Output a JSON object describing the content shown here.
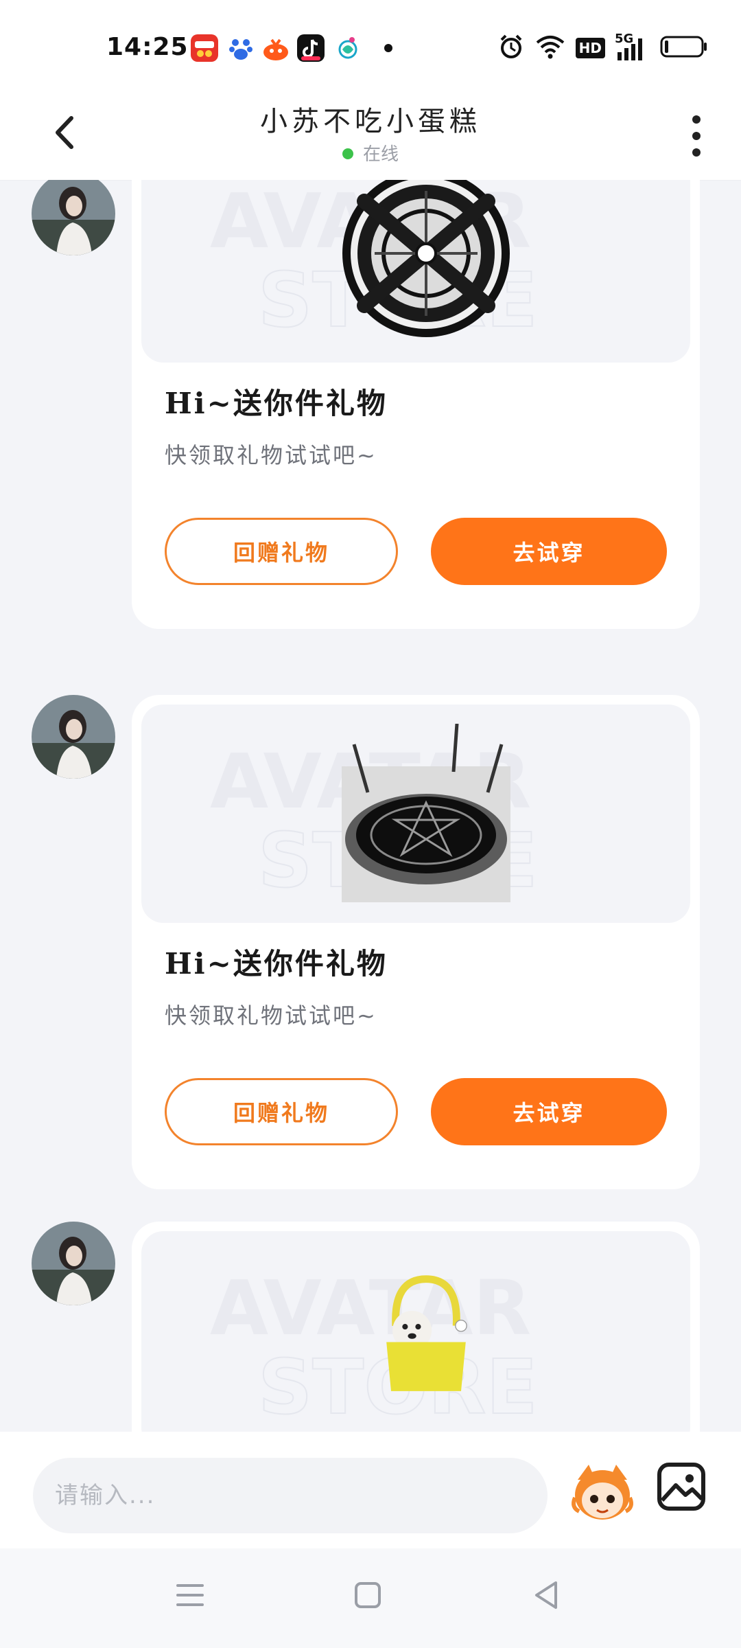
{
  "status_bar": {
    "time": "14:25",
    "network_badge": "HD",
    "network_type": "5G",
    "notification_icons": [
      "food-app-icon",
      "baidu-icon",
      "taobao-icon",
      "tiktok-icon",
      "mobile-service-icon"
    ],
    "status_icons": [
      "alarm-icon",
      "wifi-icon",
      "hd-icon",
      "signal-icon",
      "battery-icon"
    ]
  },
  "header": {
    "title": "小苏不吃小蛋糕",
    "presence": "在线",
    "presence_color": "#3cc24a"
  },
  "messages": [
    {
      "image": "magic-circle-gift-image",
      "watermark_line1": "AVATAR",
      "watermark_line2": "STORE",
      "title": "Hi~送你件礼物",
      "subtitle": "快领取礼物试试吧~",
      "return_label": "回赠礼物",
      "try_label": "去试穿"
    },
    {
      "image": "magic-ring-gift-image",
      "watermark_line1": "AVATAR",
      "watermark_line2": "STORE",
      "title": "Hi~送你件礼物",
      "subtitle": "快领取礼物试试吧~",
      "return_label": "回赠礼物",
      "try_label": "去试穿"
    },
    {
      "image": "dog-bag-gift-image",
      "watermark_line1": "AVATAR",
      "watermark_line2": "STORE",
      "title": "",
      "subtitle": "",
      "return_label": "",
      "try_label": ""
    }
  ],
  "input": {
    "placeholder": "请输入..."
  },
  "colors": {
    "accent": "#ff7418",
    "accent_outline": "#f3832c",
    "online": "#3cc24a",
    "page_bg": "#f3f4f8"
  },
  "nav": {
    "icons": [
      "menu-icon",
      "home-icon",
      "back-triangle-icon"
    ]
  }
}
